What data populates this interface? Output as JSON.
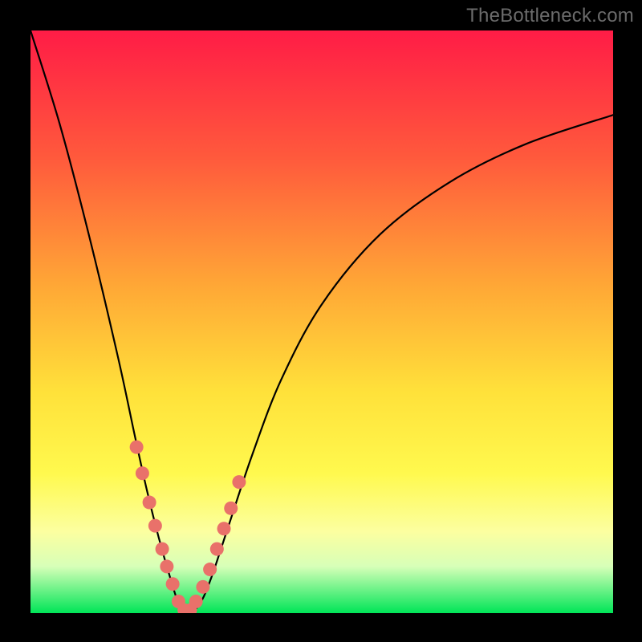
{
  "watermark": "TheBottleneck.com",
  "chart_data": {
    "type": "line",
    "title": "",
    "xlabel": "",
    "ylabel": "",
    "xlim": [
      0,
      1
    ],
    "ylim": [
      0,
      100
    ],
    "series": [
      {
        "name": "bottleneck-curve",
        "x": [
          0.0,
          0.05,
          0.1,
          0.15,
          0.18,
          0.2,
          0.22,
          0.24,
          0.255,
          0.27,
          0.29,
          0.31,
          0.34,
          0.38,
          0.43,
          0.5,
          0.6,
          0.72,
          0.85,
          1.0
        ],
        "y": [
          100.0,
          84.0,
          65.0,
          44.0,
          30.0,
          21.0,
          13.0,
          6.0,
          1.5,
          0.0,
          1.5,
          6.0,
          15.0,
          27.0,
          40.0,
          53.0,
          65.0,
          74.0,
          80.5,
          85.5
        ]
      }
    ],
    "markers": {
      "name": "highlight-dots",
      "x": [
        0.182,
        0.192,
        0.204,
        0.214,
        0.226,
        0.234,
        0.244,
        0.254,
        0.264,
        0.274,
        0.284,
        0.296,
        0.308,
        0.32,
        0.332,
        0.344,
        0.358
      ],
      "y": [
        28.5,
        24.0,
        19.0,
        15.0,
        11.0,
        8.0,
        5.0,
        2.0,
        0.5,
        0.5,
        2.0,
        4.5,
        7.5,
        11.0,
        14.5,
        18.0,
        22.5
      ]
    },
    "colors": {
      "curve": "#000000",
      "marker": "#e9716a"
    }
  }
}
